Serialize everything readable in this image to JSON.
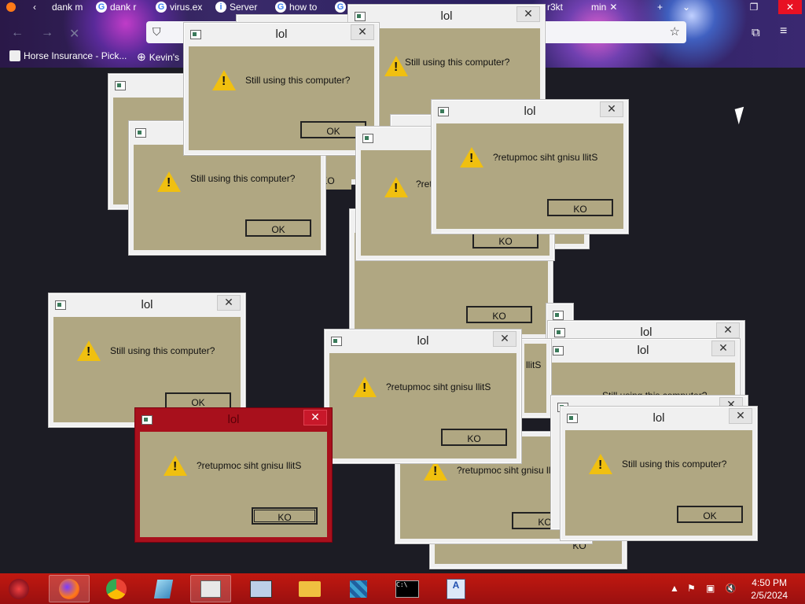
{
  "browser": {
    "tabs": [
      "dank m",
      "dank r",
      "virus.ex",
      "Server",
      "how to",
      "r3kt",
      "min"
    ],
    "bookmarks": [
      "Horse Insurance - Pick...",
      "Kevin's"
    ],
    "window_controls": [
      "—",
      "❐",
      "✕"
    ]
  },
  "dialogs": [
    {
      "title": "lol",
      "message": "Still using this computer?",
      "button": "OK"
    },
    {
      "title": "lol",
      "message": "?retupmoc siht gnisu llitS",
      "button": "KO"
    }
  ],
  "visible_fragments": {
    "ko": "KO",
    "ok": "OK",
    "partial_msg": "?retu",
    "partial_title": "lol",
    "tail_s": "llitS"
  },
  "taskbar": {
    "apps": [
      "start-orb",
      "firefox",
      "chrome",
      "notepad",
      "explorer-window",
      "system-monitor",
      "file-explorer",
      "registry",
      "command-prompt",
      "wordpad"
    ],
    "active_app": "explorer-window",
    "time": "4:50 PM",
    "date": "2/5/2024"
  },
  "colors": {
    "dialog_body": "#b0a782",
    "taskbar": "#b01410",
    "active_dialog": "#a8101c",
    "warning": "#f0c010"
  }
}
